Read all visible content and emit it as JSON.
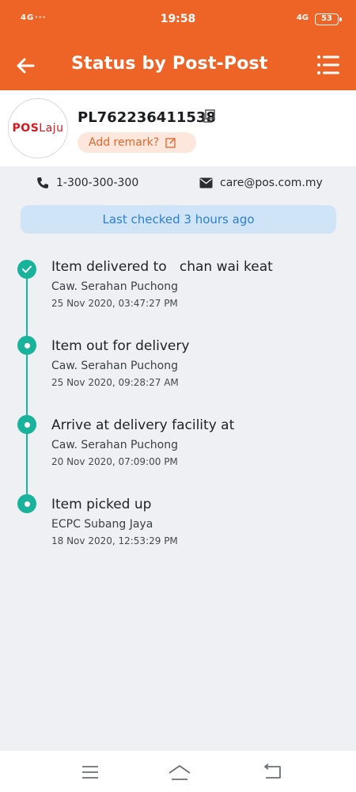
{
  "status_bar": {
    "signal": "4G",
    "time": "19:58",
    "right_network": "4G",
    "battery": "53"
  },
  "header": {
    "title": "Status by Post-Post",
    "back_icon": "arrow-left-icon",
    "menu_icon": "list-menu-icon",
    "background": "#ee6426"
  },
  "parcel": {
    "logo_pos": "POS",
    "logo_laju": "Laju",
    "tracking_number": "PL762236411538",
    "remark_label": "Add remark?"
  },
  "contact": {
    "phone": "1-300-300-300",
    "email": "care@pos.com.my"
  },
  "last_checked": "Last checked 3 hours ago",
  "events": [
    {
      "title": "Item delivered to   chan wai keat",
      "location": "Caw. Serahan Puchong",
      "datetime": "25 Nov 2020, 03:47:27 PM",
      "status": "delivered"
    },
    {
      "title": "Item out for delivery",
      "location": "Caw. Serahan Puchong",
      "datetime": "25 Nov 2020, 09:28:27 AM",
      "status": "step"
    },
    {
      "title": "Arrive at delivery facility at",
      "location": "Caw. Serahan Puchong",
      "datetime": "20 Nov 2020, 07:09:00 PM",
      "status": "step"
    },
    {
      "title": "Item picked up",
      "location": "ECPC Subang Jaya",
      "datetime": "18 Nov 2020, 12:53:29 PM",
      "status": "step"
    }
  ],
  "colors": {
    "accent": "#ee6426",
    "timeline": "#18b39a",
    "info_banner": "#cfe4f7"
  },
  "nav": [
    "menu-icon",
    "home-icon",
    "back-icon"
  ]
}
